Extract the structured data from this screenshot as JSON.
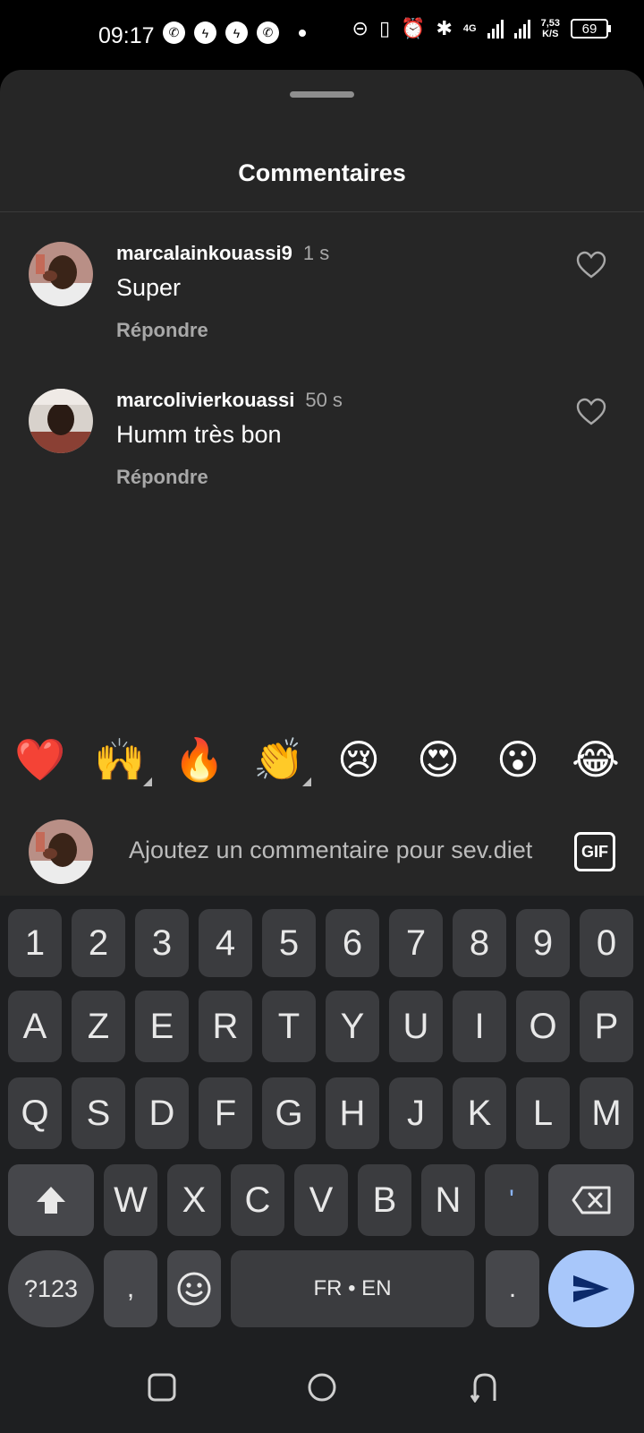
{
  "status_bar": {
    "time": "09:17",
    "apps": [
      "whatsapp-icon",
      "messenger-icon",
      "messenger-icon",
      "whatsapp-icon"
    ],
    "network": "4G",
    "speed": "7,53",
    "speed_unit": "K/S",
    "battery": "69"
  },
  "sheet": {
    "title": "Commentaires"
  },
  "comments": [
    {
      "username": "marcalainkouassi9",
      "time": "1 s",
      "text": "Super",
      "reply": "Répondre"
    },
    {
      "username": "marcolivierkouassi",
      "time": "50 s",
      "text": "Humm très bon",
      "reply": "Répondre"
    }
  ],
  "emoji_bar": [
    "❤️",
    "🙌",
    "🔥",
    "👏",
    "😢",
    "😍",
    "😮",
    "😂"
  ],
  "comment_input": {
    "placeholder": "Ajoutez un commentaire pour sev.diet",
    "gif_label": "GIF"
  },
  "keyboard": {
    "row1": [
      "1",
      "2",
      "3",
      "4",
      "5",
      "6",
      "7",
      "8",
      "9",
      "0"
    ],
    "row2": [
      "A",
      "Z",
      "E",
      "R",
      "T",
      "Y",
      "U",
      "I",
      "O",
      "P"
    ],
    "row3": [
      "Q",
      "S",
      "D",
      "F",
      "G",
      "H",
      "J",
      "K",
      "L",
      "M"
    ],
    "row4": [
      "W",
      "X",
      "C",
      "V",
      "B",
      "N",
      "'"
    ],
    "symbols_key": "?123",
    "comma": ",",
    "space_label": "FR • EN",
    "period": "."
  },
  "colors": {
    "sheet_bg": "#262626",
    "send_key": "#a8c7fa",
    "accent_text": "#a8a8a8"
  }
}
